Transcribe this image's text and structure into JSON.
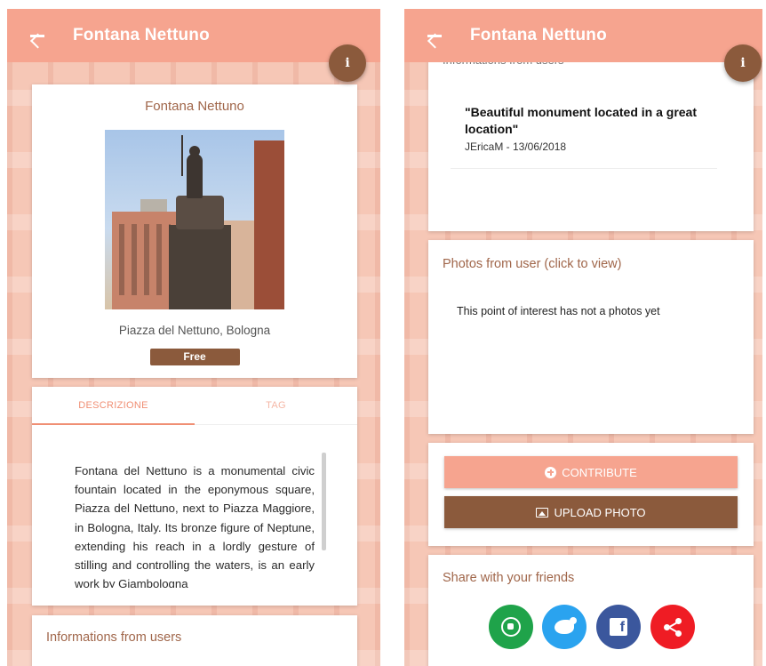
{
  "left_screen": {
    "appbar": {
      "title": "Fontana Nettuno"
    },
    "info_button": {
      "label": "i"
    },
    "poi": {
      "name": "Fontana Nettuno",
      "address": "Piazza del Nettuno, Bologna",
      "price_badge": "Free"
    },
    "tabs": [
      {
        "label": "DESCRIZIONE",
        "active": true
      },
      {
        "label": "TAG",
        "active": false
      }
    ],
    "description": "Fontana del Nettuno is a monumental civic fountain located in the eponymous square, Piazza del Nettuno, next to Piazza Maggiore, in Bologna, Italy. Its bronze figure of Neptune, extending his reach in a lordly gesture of stilling and controlling the waters, is an early work by Giambologna",
    "users_section": {
      "title": "Informations from users"
    }
  },
  "right_screen": {
    "appbar": {
      "title": "Fontana Nettuno"
    },
    "info_button": {
      "label": "i"
    },
    "users_section": {
      "title": "Informations from users",
      "review": {
        "quote": "\"Beautiful monument located in a great location\"",
        "author_date": "JEricaM - 13/06/2018"
      }
    },
    "photos_section": {
      "title": "Photos from user (click to view)",
      "empty_text": "This point of interest has not a photos yet"
    },
    "actions": {
      "contribute_label": "CONTRIBUTE",
      "upload_label": "UPLOAD PHOTO"
    },
    "share_section": {
      "title": "Share with your friends",
      "buttons": [
        "whatsapp-icon",
        "twitter-icon",
        "facebook-icon",
        "share-icon"
      ]
    }
  },
  "colors": {
    "appbar": "#f6a48f",
    "accent_brown": "#8b5a3c",
    "tab_active": "#f08f74",
    "whatsapp": "#1fa34a",
    "twitter": "#2aa3ef",
    "facebook": "#3b579d",
    "share": "#ef1c24"
  }
}
